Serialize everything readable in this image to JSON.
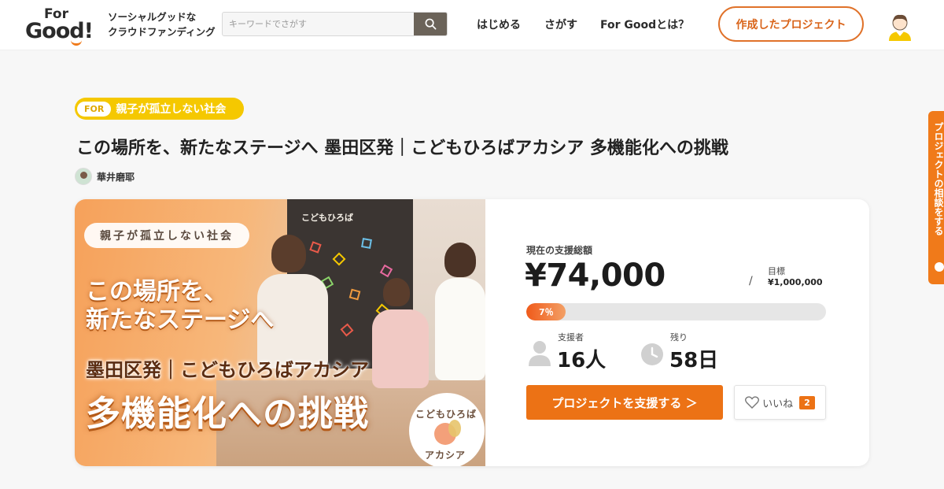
{
  "header": {
    "logo": {
      "line1": "For",
      "line2": "Good!"
    },
    "tagline": [
      "ソーシャルグッドな",
      "クラウドファンディング"
    ],
    "search": {
      "placeholder": "キーワードでさがす",
      "value": ""
    },
    "nav": [
      "はじめる",
      "さがす",
      "For Goodとは？"
    ],
    "created_projects": "作成したプロジェクト"
  },
  "side_tab": {
    "label": "プロジェクトの相談をする"
  },
  "theme": {
    "prefix": "FOR",
    "label": "親子が孤立しない社会"
  },
  "project": {
    "title": "この場所を、新たなステージへ 墨田区発｜こどもひろばアカシア 多機能化への挑戦",
    "owner": "華井磨耶"
  },
  "hero": {
    "pill": "親子が孤立しない社会",
    "line1": "この場所を、",
    "line2": "新たなステージへ",
    "line3": "墨田区発｜こどもひろばアカシア",
    "line4": "多機能化への挑戦",
    "board_text": "こどもひろば",
    "badge_top": "こどもひろば",
    "badge_bottom": "アカシア"
  },
  "stats": {
    "total_label": "現在の支援総額",
    "total": "¥74,000",
    "slash": "/",
    "goal_label": "目標",
    "goal": "¥1,000,000",
    "progress_percent": 7,
    "progress_label": "7％",
    "supporters_label": "支援者",
    "supporters": "16人",
    "remaining_label": "残り",
    "remaining": "58日",
    "support_button": "プロジェクトを支援する ＞",
    "like_label": "いいね",
    "like_count": "2"
  },
  "colors": {
    "accent": "#ec7215",
    "theme_yellow": "#f5c800",
    "brown": "#6b6359"
  }
}
